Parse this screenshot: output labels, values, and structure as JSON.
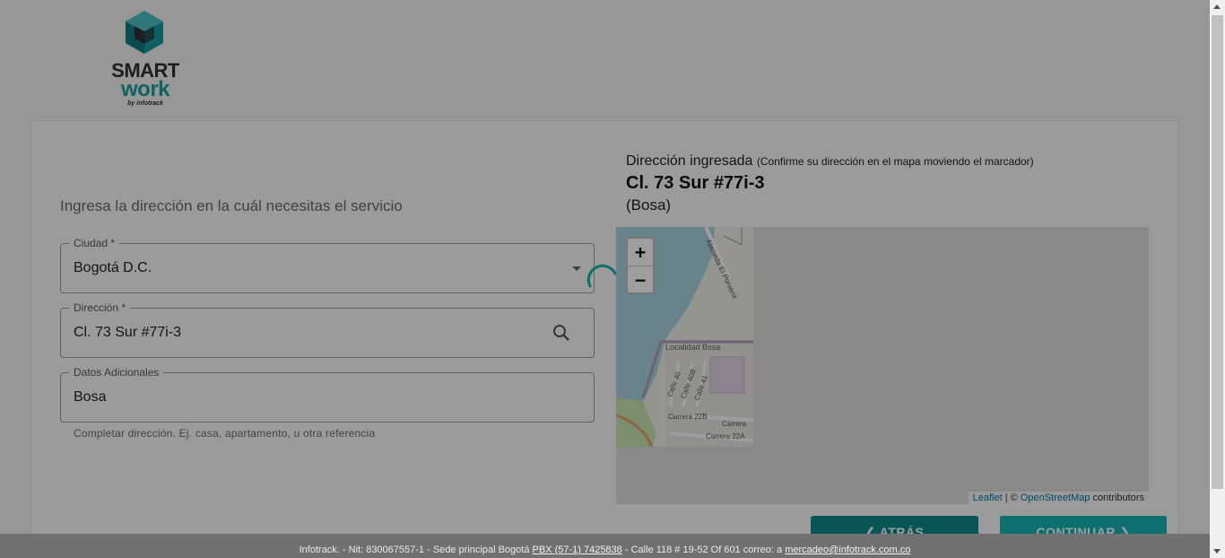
{
  "logo": {
    "line1": "SMART",
    "line2": "work",
    "line3": "by infotrack"
  },
  "form": {
    "heading": "Ingresa la dirección en la cuál necesitas el servicio",
    "city": {
      "label": "Ciudad *",
      "value": "Bogotá D.C."
    },
    "address": {
      "label": "Dirección *",
      "value": "Cl. 73 Sur #77i-3"
    },
    "extra": {
      "label": "Datos Adicionales",
      "value": "Bosa"
    },
    "hint": "Completar dirección. Ej. casa, apartamento, u otra referencia"
  },
  "address_panel": {
    "title": "Dirección ingresada",
    "note": "(Confirme su dirección en el mapa moviendo el marcador)",
    "address": "Cl. 73 Sur #77i-3",
    "locality": "(Bosa)"
  },
  "map": {
    "zoom_in": "+",
    "zoom_out": "−",
    "attribution_leaflet": "Leaflet",
    "attribution_sep": " | © ",
    "attribution_osm": "OpenStreetMap",
    "attribution_tail": " contributors",
    "street_labels": [
      "Localidad Bosa",
      "Calle 40",
      "Calle 40B",
      "Calle 41",
      "Carrera 22B",
      "Carrera 22A",
      "Carrera",
      "Alameda El Porvenir"
    ]
  },
  "buttons": {
    "back": "❮ ATRÁS",
    "next": "CONTINUAR ❯"
  },
  "footer": {
    "text1": "Infotrack. - Nit: 830067557-1 - Sede principal Bogotá ",
    "phone": "PBX (57-1) 7425838",
    "text2": " - Calle 118 # 19-52 Of 601   correo: a ",
    "email": "mercadeo@infotrack.com.co"
  },
  "colors": {
    "teal_dark": "#0e8a8b",
    "teal": "#17b3b4",
    "logo_teal": "#17a09f"
  }
}
